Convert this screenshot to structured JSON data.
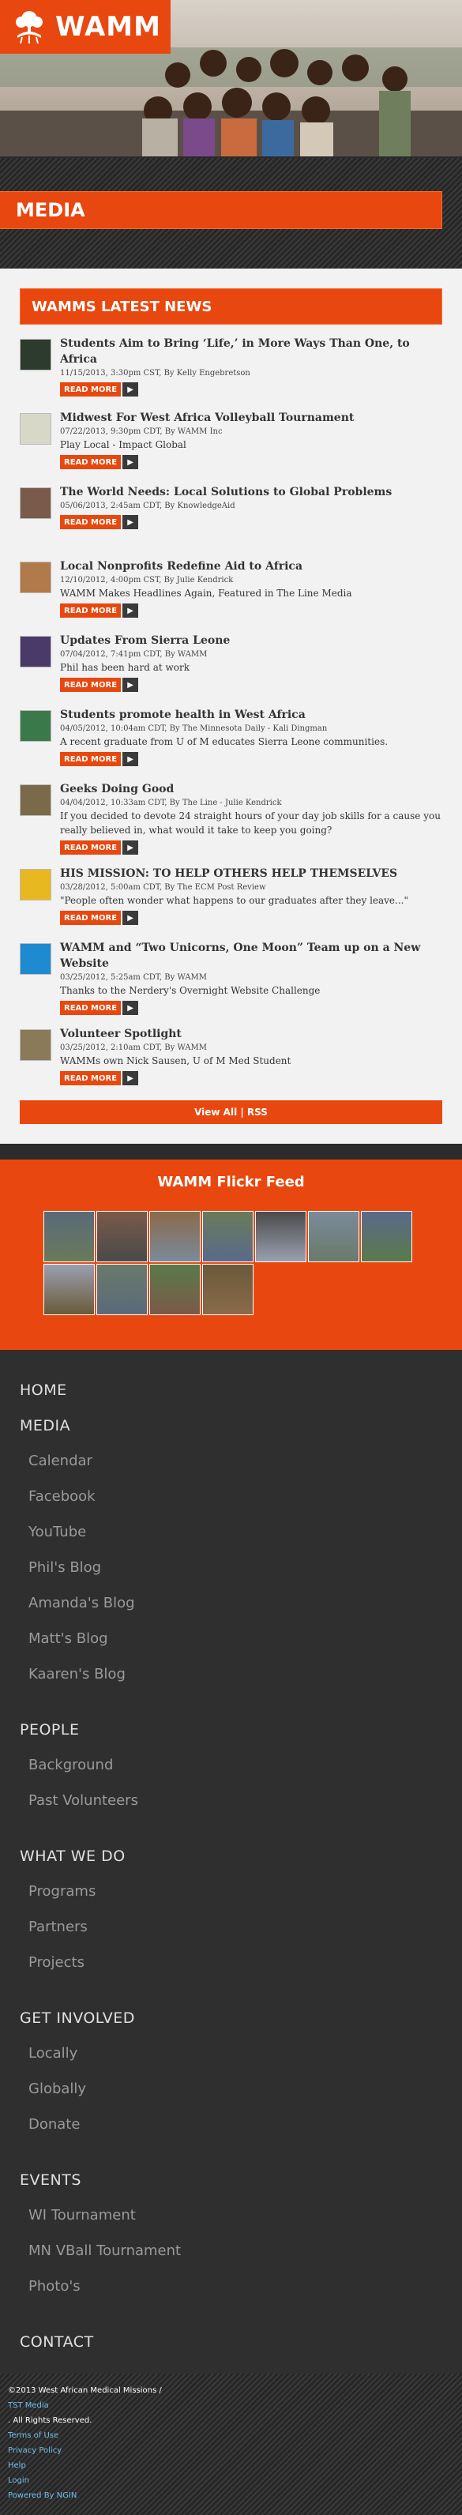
{
  "brand": {
    "name": "WAMM",
    "color": "#e8480f"
  },
  "page": {
    "title": "MEDIA"
  },
  "news": {
    "heading": "WAMMS LATEST NEWS",
    "read_more": "READ MORE",
    "items": [
      {
        "title": "Students Aim to Bring ‘Life,’ in More Ways Than One, to Africa",
        "meta": "11/15/2013, 3:30pm CST, By Kelly Engebretson",
        "desc": ""
      },
      {
        "title": "Midwest For West Africa Volleyball Tournament",
        "meta": "07/22/2013, 9:30pm CDT, By WAMM Inc",
        "desc": "Play Local - Impact Global"
      },
      {
        "title": "The World Needs: Local Solutions to Global Problems",
        "meta": "05/06/2013, 2:45am CDT, By KnowledgeAid",
        "desc": ""
      },
      {
        "title": "Local Nonprofits Redefine Aid to Africa",
        "meta": "12/10/2012, 4:00pm CST, By Julie Kendrick",
        "desc": "WAMM Makes Headlines Again, Featured in The Line Media"
      },
      {
        "title": "Updates From Sierra Leone",
        "meta": "07/04/2012, 7:41pm CDT, By WAMM",
        "desc": "Phil has been hard at work"
      },
      {
        "title": "Students promote health in West Africa",
        "meta": "04/05/2012, 10:04am CDT, By The Minnesota Daily - Kali Dingman",
        "desc": "A recent graduate from U of M educates Sierra Leone communities."
      },
      {
        "title": "Geeks Doing Good",
        "meta": "04/04/2012, 10:33am CDT, By The Line - Julie Kendrick",
        "desc": "If you decided to devote 24 straight hours of your day job skills for a cause you really believed in, what would it take to keep you going?"
      },
      {
        "title": "HIS MISSION: TO HELP OTHERS HELP THEMSELVES",
        "meta": "03/28/2012, 5:00am CDT, By The ECM Post Review",
        "desc": "\"People often wonder what happens to our graduates after they leave...\""
      },
      {
        "title": "WAMM and “Two Unicorns, One Moon” Team up on a New Website",
        "meta": "03/25/2012, 5:25am CDT, By WAMM",
        "desc": "Thanks to the Nerdery's Overnight Website Challenge"
      },
      {
        "title": "Volunteer Spotlight",
        "meta": "03/25/2012, 2:10am CDT, By WAMM",
        "desc": "WAMMs own Nick Sausen, U of M Med Student"
      }
    ],
    "view_all": "View All | RSS"
  },
  "flickr": {
    "title": "WAMM Flickr Feed",
    "count": 11
  },
  "nav": [
    {
      "label": "HOME",
      "sub": []
    },
    {
      "label": "MEDIA",
      "sub": [
        "Calendar",
        "Facebook",
        "YouTube",
        "Phil's Blog",
        "Amanda's Blog",
        "Matt's Blog",
        "Kaaren's Blog"
      ]
    },
    {
      "label": "PEOPLE",
      "sub": [
        "Background",
        "Past Volunteers"
      ]
    },
    {
      "label": "WHAT WE DO",
      "sub": [
        "Programs",
        "Partners",
        "Projects"
      ]
    },
    {
      "label": "GET INVOLVED",
      "sub": [
        "Locally",
        "Globally",
        "Donate"
      ]
    },
    {
      "label": "EVENTS",
      "sub": [
        "WI Tournament",
        "MN VBall Tournament",
        "Photo's"
      ]
    },
    {
      "label": "CONTACT",
      "sub": []
    }
  ],
  "legal": {
    "copyright": "©2013 West African Medical Missions /",
    "tst": "TST Media",
    "rights": ". All Rights Reserved.",
    "links": [
      "Terms of Use",
      "Privacy Policy",
      "Help",
      "Login",
      "Powered By NGIN"
    ]
  }
}
